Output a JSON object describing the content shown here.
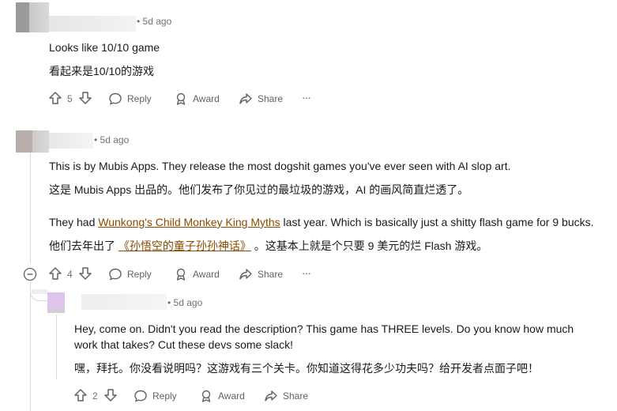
{
  "comments": [
    {
      "time": "• 5d ago",
      "lines": [
        "Looks like 10/10 game",
        "看起来是10/10的游戏"
      ],
      "votes": "5",
      "reply": "Reply",
      "award": "Award",
      "share": "Share",
      "more": "···"
    },
    {
      "time": "• 5d ago",
      "lines": [
        "This is by Mubis Apps. They release the most dogshit games you've ever seen with AI slop art.",
        "这是 Mubis Apps 出品的。他们发布了你见过的最垃圾的游戏，AI 的画风简直烂透了。"
      ],
      "line3_pre": "They had ",
      "line3_link": "Wunkong's Child Monkey King Myths",
      "line3_post": " last year. Which is basically just a shitty flash game for 9 bucks.",
      "line4_pre": "他们去年出了 ",
      "line4_link": "《孙悟空的童子孙孙神话》",
      "line4_post": " 。这基本上就是个只要 9 美元的烂 Flash 游戏。",
      "collapse": "−",
      "votes": "4",
      "reply": "Reply",
      "award": "Award",
      "share": "Share",
      "more": "···"
    },
    {
      "time": "• 5d ago",
      "line1": "Hey, come on. Didn't you read the description? This game has THREE levels. Do you know how much",
      "line2": "work that takes? Cut these devs some slack!",
      "line3": "嘿，拜托。你没看说明吗？这游戏有三个关卡。你知道这得花多少功夫吗？给开发者点面子吧！",
      "votes": "2",
      "reply": "Reply",
      "award": "Award",
      "share": "Share"
    }
  ],
  "colors": {
    "link": "#8a4a00",
    "meta": "#6f7175",
    "thread_line": "#d7d9dc"
  },
  "icons": [
    "upvote-icon",
    "downvote-icon",
    "reply-icon",
    "award-icon",
    "share-icon",
    "more-icon",
    "collapse-icon"
  ]
}
